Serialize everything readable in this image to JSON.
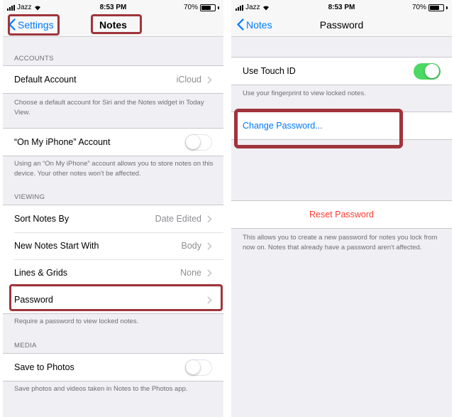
{
  "left": {
    "status": {
      "carrier": "Jazz",
      "time": "8:53 PM",
      "battery": "70%"
    },
    "nav": {
      "back_label": "Settings",
      "title": "Notes"
    },
    "accounts": {
      "header": "ACCOUNTS",
      "default_account": {
        "label": "Default Account",
        "value": "iCloud"
      },
      "default_footer": "Choose a default account for Siri and the Notes widget in Today View.",
      "on_my_iphone": {
        "label": "“On My iPhone” Account",
        "toggle": "off"
      },
      "on_my_iphone_footer": "Using an “On My iPhone” account allows you to store notes on this device. Your other notes won't be affected."
    },
    "viewing": {
      "header": "VIEWING",
      "rows": [
        {
          "label": "Sort Notes By",
          "value": "Date Edited"
        },
        {
          "label": "New Notes Start With",
          "value": "Body"
        },
        {
          "label": "Lines & Grids",
          "value": "None"
        },
        {
          "label": "Password",
          "value": ""
        }
      ],
      "footer": "Require a password to view locked notes."
    },
    "media": {
      "header": "MEDIA",
      "save_to_photos": {
        "label": "Save to Photos",
        "toggle": "off"
      },
      "footer": "Save photos and videos taken in Notes to the Photos app."
    }
  },
  "right": {
    "status": {
      "carrier": "Jazz",
      "time": "8:53 PM",
      "battery": "70%"
    },
    "nav": {
      "back_label": "Notes",
      "title": "Password"
    },
    "touch_id": {
      "label": "Use Touch ID",
      "toggle": "on"
    },
    "touch_id_footer": "Use your fingerprint to view locked notes.",
    "change_password": "Change Password...",
    "reset_password": "Reset Password",
    "reset_footer": "This allows you to create a new password for notes you lock from now on. Notes that already have a password aren't affected."
  },
  "colors": {
    "ios_blue": "#007aff",
    "ios_red": "#ff3b30",
    "ios_green": "#4cd964",
    "annotation": "#a0343b",
    "group_bg": "#efeff4"
  }
}
